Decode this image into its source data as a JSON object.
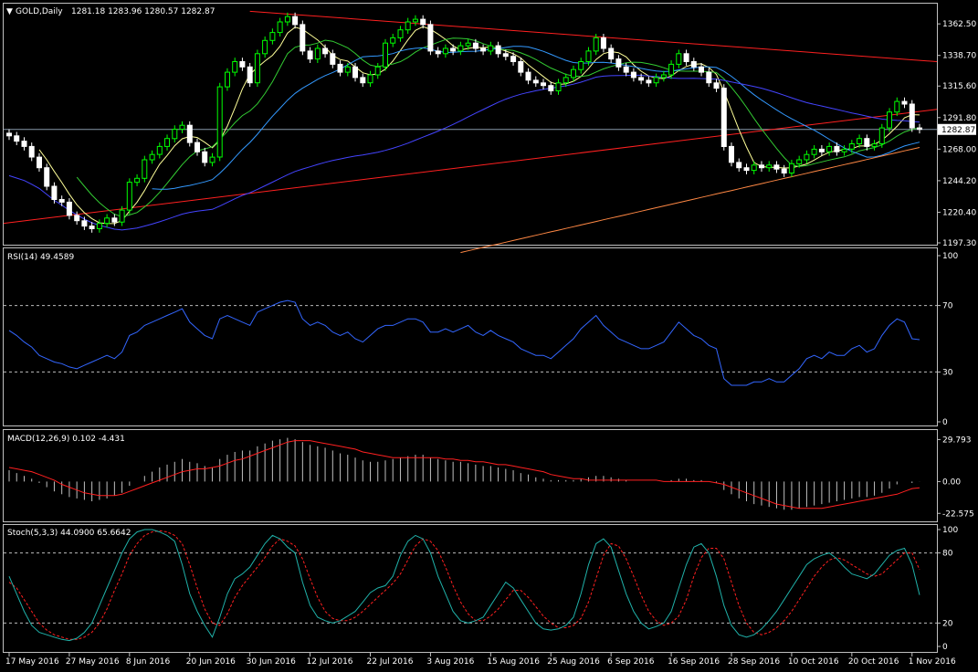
{
  "header": {
    "symbol_label": "GOLD,Daily",
    "ohlc": "1281.18 1283.96 1280.57 1282.87"
  },
  "colors": {
    "background": "#000000",
    "frame": "#c0c0c0",
    "text": "#ffffff",
    "bull": "#00ff00",
    "bear": "#ffffff",
    "sma_fast": "#ffff99",
    "sma_mid": "#33cc33",
    "sma_slow": "#3399ff",
    "sma_100": "#4444ff",
    "sma_200": "#ff8844",
    "trendline": "#ff2020",
    "rsi": "#3366ff",
    "macd_hist": "#c0c0c0",
    "macd_signal": "#ff2020",
    "stoch_main": "#20b2aa",
    "stoch_signal": "#ff2020"
  },
  "chart_data": [
    {
      "type": "candlestick",
      "name": "price",
      "ylim": [
        1197.3,
        1375.0
      ],
      "yticks": [
        "1362.50",
        "1338.70",
        "1315.60",
        "1291.80",
        "1268.00",
        "1244.20",
        "1220.40",
        "1197.30"
      ],
      "last_price_label": "1282.87",
      "last_price": 1282.87,
      "xticks": [
        {
          "i": 0,
          "label": "17 May 2016"
        },
        {
          "i": 8,
          "label": "27 May 2016"
        },
        {
          "i": 16,
          "label": "8 Jun 2016"
        },
        {
          "i": 24,
          "label": "20 Jun 2016"
        },
        {
          "i": 32,
          "label": "30 Jun 2016"
        },
        {
          "i": 40,
          "label": "12 Jul 2016"
        },
        {
          "i": 48,
          "label": "22 Jul 2016"
        },
        {
          "i": 56,
          "label": "3 Aug 2016"
        },
        {
          "i": 64,
          "label": "15 Aug 2016"
        },
        {
          "i": 72,
          "label": "25 Aug 2016"
        },
        {
          "i": 80,
          "label": "6 Sep 2016"
        },
        {
          "i": 88,
          "label": "16 Sep 2016"
        },
        {
          "i": 96,
          "label": "28 Sep 2016"
        },
        {
          "i": 104,
          "label": "10 Oct 2016"
        },
        {
          "i": 112,
          "label": "20 Oct 2016"
        },
        {
          "i": 120,
          "label": "1 Nov 2016"
        }
      ],
      "close": [
        1278,
        1274,
        1270,
        1262,
        1254,
        1240,
        1230,
        1228,
        1218,
        1214,
        1210,
        1208,
        1212,
        1216,
        1213,
        1222,
        1243,
        1246,
        1260,
        1264,
        1270,
        1276,
        1283,
        1286,
        1273,
        1266,
        1258,
        1262,
        1315,
        1326,
        1334,
        1330,
        1318,
        1340,
        1350,
        1356,
        1364,
        1368,
        1362,
        1342,
        1336,
        1344,
        1340,
        1332,
        1326,
        1330,
        1322,
        1318,
        1324,
        1330,
        1348,
        1352,
        1358,
        1364,
        1366,
        1362,
        1342,
        1340,
        1344,
        1342,
        1346,
        1348,
        1344,
        1342,
        1346,
        1340,
        1338,
        1334,
        1326,
        1320,
        1318,
        1316,
        1312,
        1318,
        1322,
        1328,
        1334,
        1342,
        1352,
        1344,
        1336,
        1330,
        1326,
        1322,
        1320,
        1318,
        1322,
        1324,
        1332,
        1340,
        1334,
        1330,
        1326,
        1318,
        1314,
        1270,
        1258,
        1254,
        1252,
        1256,
        1254,
        1256,
        1253,
        1250,
        1257,
        1260,
        1264,
        1268,
        1266,
        1270,
        1266,
        1268,
        1272,
        1276,
        1270,
        1272,
        1284,
        1296,
        1304,
        1302,
        1284,
        1282.87
      ],
      "open": null
    },
    {
      "type": "line",
      "name": "RSI(14)",
      "title": "RSI(14) 49.4589",
      "ylim": [
        0,
        100
      ],
      "yticks": [
        "100",
        "70",
        "30",
        "0"
      ],
      "levels": [
        70,
        30
      ],
      "values": [
        55,
        52,
        48,
        45,
        40,
        38,
        36,
        35,
        33,
        32,
        34,
        36,
        38,
        40,
        38,
        42,
        52,
        54,
        58,
        60,
        62,
        64,
        66,
        68,
        60,
        56,
        52,
        50,
        62,
        64,
        62,
        60,
        58,
        66,
        68,
        70,
        72,
        73,
        72,
        62,
        58,
        60,
        58,
        54,
        52,
        54,
        50,
        48,
        52,
        56,
        58,
        58,
        60,
        62,
        62,
        60,
        54,
        54,
        56,
        54,
        56,
        58,
        54,
        52,
        55,
        52,
        50,
        48,
        44,
        42,
        40,
        40,
        38,
        42,
        46,
        50,
        56,
        60,
        64,
        58,
        54,
        50,
        48,
        46,
        44,
        44,
        46,
        48,
        54,
        60,
        56,
        52,
        50,
        46,
        44,
        26,
        22,
        22,
        22,
        24,
        24,
        26,
        24,
        24,
        28,
        32,
        38,
        40,
        38,
        42,
        40,
        40,
        44,
        46,
        42,
        44,
        52,
        58,
        62,
        60,
        50,
        49.4589
      ]
    },
    {
      "type": "bar+line",
      "name": "MACD(12,26,9)",
      "title": "MACD(12,26,9) 0.102 -4.431",
      "ylim": [
        -25.0,
        32.0
      ],
      "yticks": [
        "29.793",
        "0.00",
        "-22.575"
      ],
      "histogram": [
        8,
        6,
        4,
        2,
        -1,
        -4,
        -7,
        -9,
        -11,
        -12,
        -13,
        -14,
        -13,
        -12,
        -10,
        -8,
        -3,
        0,
        4,
        7,
        10,
        12,
        14,
        16,
        14,
        13,
        11,
        10,
        16,
        19,
        21,
        22,
        22,
        25,
        27,
        29,
        30,
        31,
        30,
        28,
        26,
        25,
        24,
        22,
        20,
        19,
        17,
        15,
        14,
        14,
        15,
        16,
        17,
        18,
        19,
        19,
        17,
        16,
        15,
        14,
        14,
        13,
        12,
        11,
        11,
        10,
        9,
        8,
        6,
        5,
        3,
        2,
        1,
        1,
        1,
        1,
        2,
        3,
        4,
        4,
        3,
        2,
        1,
        0,
        0,
        0,
        0,
        0,
        1,
        2,
        2,
        1,
        1,
        0,
        -1,
        -6,
        -9,
        -12,
        -14,
        -16,
        -17,
        -18,
        -19,
        -20,
        -20,
        -19,
        -18,
        -17,
        -16,
        -15,
        -14,
        -13,
        -12,
        -11,
        -11,
        -10,
        -8,
        -5,
        -2,
        0,
        -1,
        0.102
      ],
      "signal": [
        10,
        9,
        8,
        7,
        5,
        3,
        1,
        -2,
        -4,
        -6,
        -8,
        -9,
        -10,
        -10,
        -10,
        -9,
        -7,
        -5,
        -3,
        -1,
        1,
        3,
        5,
        7,
        8,
        9,
        9,
        10,
        11,
        13,
        15,
        16,
        18,
        20,
        22,
        24,
        26,
        28,
        29,
        29,
        29,
        28,
        27,
        26,
        25,
        24,
        23,
        21,
        20,
        19,
        18,
        17,
        17,
        17,
        17,
        17,
        17,
        17,
        16,
        16,
        15,
        15,
        14,
        14,
        13,
        12,
        12,
        11,
        10,
        9,
        8,
        7,
        5,
        4,
        3,
        2,
        2,
        1,
        1,
        1,
        1,
        1,
        1,
        1,
        1,
        1,
        1,
        0,
        0,
        0,
        0,
        0,
        0,
        0,
        -1,
        -2,
        -4,
        -6,
        -8,
        -10,
        -12,
        -14,
        -16,
        -17,
        -18,
        -19,
        -19,
        -19,
        -19,
        -18,
        -17,
        -16,
        -15,
        -14,
        -13,
        -12,
        -11,
        -10,
        -9,
        -7,
        -5,
        -4.431
      ]
    },
    {
      "type": "line",
      "name": "Stoch(5,3,3)",
      "title": "Stoch(5,3,3) 44.0900 65.6642",
      "ylim": [
        0,
        100
      ],
      "yticks": [
        "100",
        "80",
        "20",
        "0"
      ],
      "levels": [
        80,
        20
      ],
      "main": [
        60,
        45,
        30,
        18,
        12,
        10,
        8,
        6,
        5,
        7,
        12,
        20,
        35,
        50,
        65,
        80,
        92,
        98,
        100,
        100,
        98,
        95,
        90,
        70,
        45,
        30,
        18,
        8,
        25,
        45,
        58,
        62,
        68,
        78,
        88,
        95,
        92,
        85,
        80,
        55,
        35,
        25,
        22,
        20,
        22,
        26,
        30,
        38,
        46,
        50,
        52,
        60,
        78,
        90,
        95,
        92,
        80,
        60,
        45,
        30,
        22,
        20,
        22,
        25,
        35,
        45,
        55,
        50,
        40,
        30,
        20,
        15,
        14,
        15,
        18,
        25,
        45,
        70,
        88,
        92,
        85,
        65,
        45,
        30,
        20,
        15,
        17,
        20,
        30,
        50,
        70,
        85,
        88,
        80,
        60,
        35,
        18,
        10,
        8,
        10,
        15,
        22,
        30,
        40,
        50,
        60,
        70,
        75,
        78,
        80,
        75,
        68,
        62,
        60,
        58,
        62,
        70,
        78,
        82,
        84,
        70,
        44.09
      ],
      "signal": [
        55,
        50,
        40,
        30,
        20,
        14,
        10,
        8,
        6,
        6,
        8,
        12,
        20,
        32,
        48,
        62,
        78,
        88,
        95,
        98,
        99,
        98,
        95,
        88,
        70,
        50,
        32,
        20,
        18,
        28,
        42,
        52,
        60,
        68,
        76,
        86,
        92,
        90,
        86,
        75,
        58,
        42,
        30,
        24,
        22,
        22,
        25,
        30,
        36,
        42,
        48,
        54,
        62,
        74,
        86,
        92,
        90,
        82,
        68,
        52,
        38,
        28,
        22,
        22,
        26,
        32,
        40,
        48,
        48,
        42,
        34,
        26,
        20,
        16,
        16,
        18,
        24,
        38,
        58,
        78,
        88,
        86,
        75,
        60,
        44,
        30,
        22,
        18,
        20,
        26,
        40,
        60,
        76,
        84,
        84,
        75,
        55,
        35,
        20,
        12,
        10,
        12,
        16,
        22,
        30,
        40,
        50,
        60,
        68,
        74,
        76,
        74,
        70,
        66,
        62,
        60,
        62,
        68,
        74,
        80,
        80,
        65.6642
      ]
    }
  ]
}
